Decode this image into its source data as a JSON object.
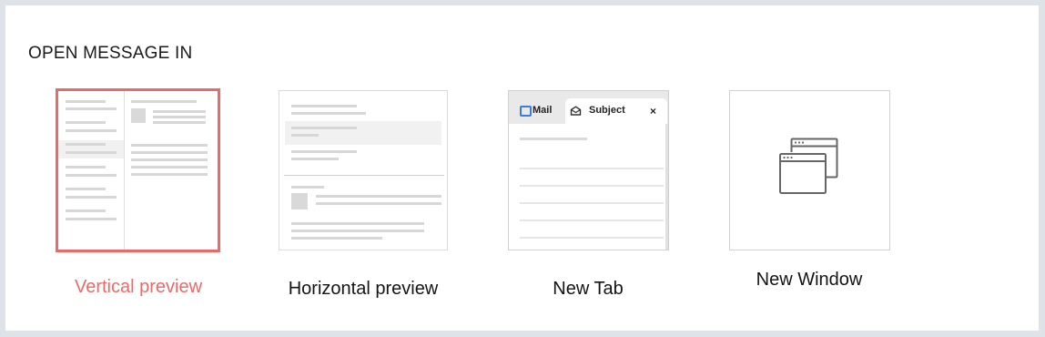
{
  "section": {
    "title": "OPEN MESSAGE IN"
  },
  "options": [
    {
      "label": "Vertical preview",
      "selected": true
    },
    {
      "label": "Horizontal preview",
      "selected": false
    },
    {
      "label": "New Tab",
      "selected": false,
      "tabs": {
        "mail": "Mail",
        "subject": "Subject",
        "close": "×"
      }
    },
    {
      "label": "New Window",
      "selected": false,
      "icon": "windows-icon"
    }
  ],
  "colors": {
    "accent": "#ea6a6a",
    "border": "#dcdcdc",
    "placeholder": "#d7d7d7",
    "tab_bg": "#e9e9e9",
    "mail_icon": "#3b7ddd"
  }
}
